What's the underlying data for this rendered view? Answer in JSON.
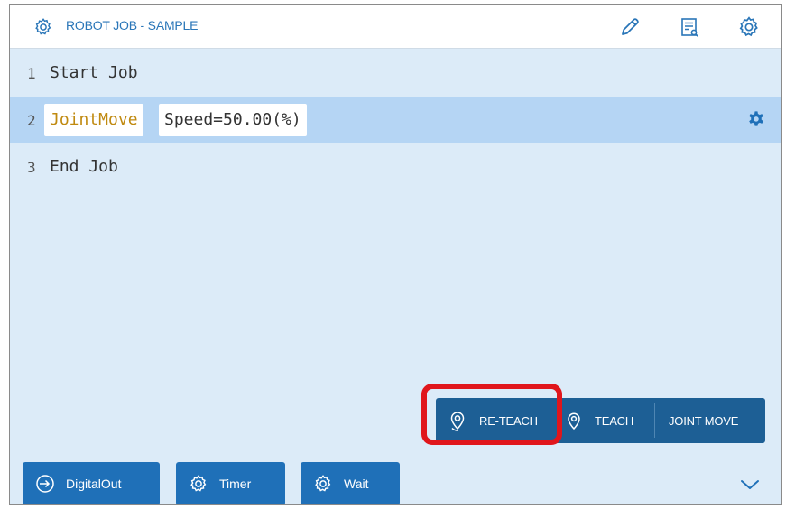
{
  "window": {
    "title": "ROBOT JOB - SAMPLE",
    "title_icon": "gear-icon",
    "toolbar": [
      {
        "name": "edit-button",
        "icon": "pencil-icon"
      },
      {
        "name": "view-list-button",
        "icon": "document-search-icon"
      },
      {
        "name": "settings-button",
        "icon": "gear-icon"
      }
    ]
  },
  "job": {
    "lines": [
      {
        "num": "1",
        "text": "Start Job"
      },
      {
        "num": "2",
        "command": "JointMove",
        "param": "Speed=50.00(%)",
        "selected": true
      },
      {
        "num": "3",
        "text": "End Job"
      }
    ]
  },
  "teach_group": {
    "reteach_label": "RE-TEACH",
    "teach_label": "TEACH",
    "joint_move_label": "JOINT MOVE"
  },
  "bottom_bar": {
    "digital_out_label": "DigitalOut",
    "timer_label": "Timer",
    "wait_label": "Wait"
  },
  "colors": {
    "accent": "#1f70b8",
    "dark_button": "#1d5f95",
    "selected_row": "#b5d5f4",
    "panel_bg": "#dcebf8",
    "command_text": "#c08a10",
    "highlight": "#e0161c"
  }
}
